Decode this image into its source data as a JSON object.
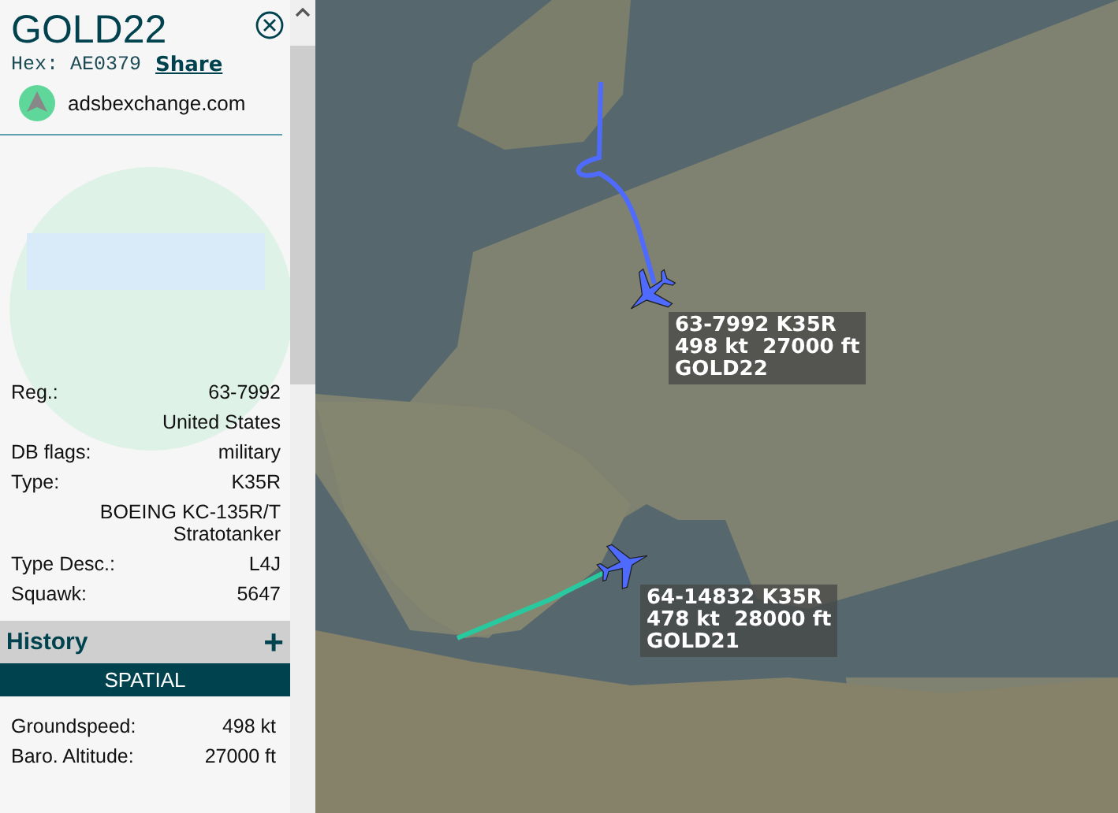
{
  "callsign": "GOLD22",
  "hex_label": "Hex:",
  "hex": "AE0379",
  "share": "Share",
  "source": "adsbexchange.com",
  "details": [
    {
      "label": "Reg.:",
      "values": [
        "63-7992",
        "United States"
      ]
    },
    {
      "label": "DB flags:",
      "values": [
        "military"
      ]
    },
    {
      "label": "Type:",
      "values": [
        "K35R",
        "BOEING KC-135R/T Stratotanker"
      ]
    },
    {
      "label": "Type Desc.:",
      "values": [
        "L4J"
      ]
    },
    {
      "label": "Squawk:",
      "values": [
        "5647"
      ]
    }
  ],
  "history": {
    "title": "History",
    "expand": "+",
    "tab": "SPATIAL"
  },
  "stats": [
    {
      "label": "Groundspeed:",
      "value": "498 kt"
    },
    {
      "label": "Baro. Altitude:",
      "value": "27000 ft"
    }
  ],
  "aircraft": [
    {
      "lines": [
        "63-7992 K35R",
        "498 kt  27000 ft",
        "GOLD22"
      ]
    },
    {
      "lines": [
        "64-14832 K35R",
        "478 kt  28000 ft",
        "GOLD21"
      ]
    }
  ]
}
